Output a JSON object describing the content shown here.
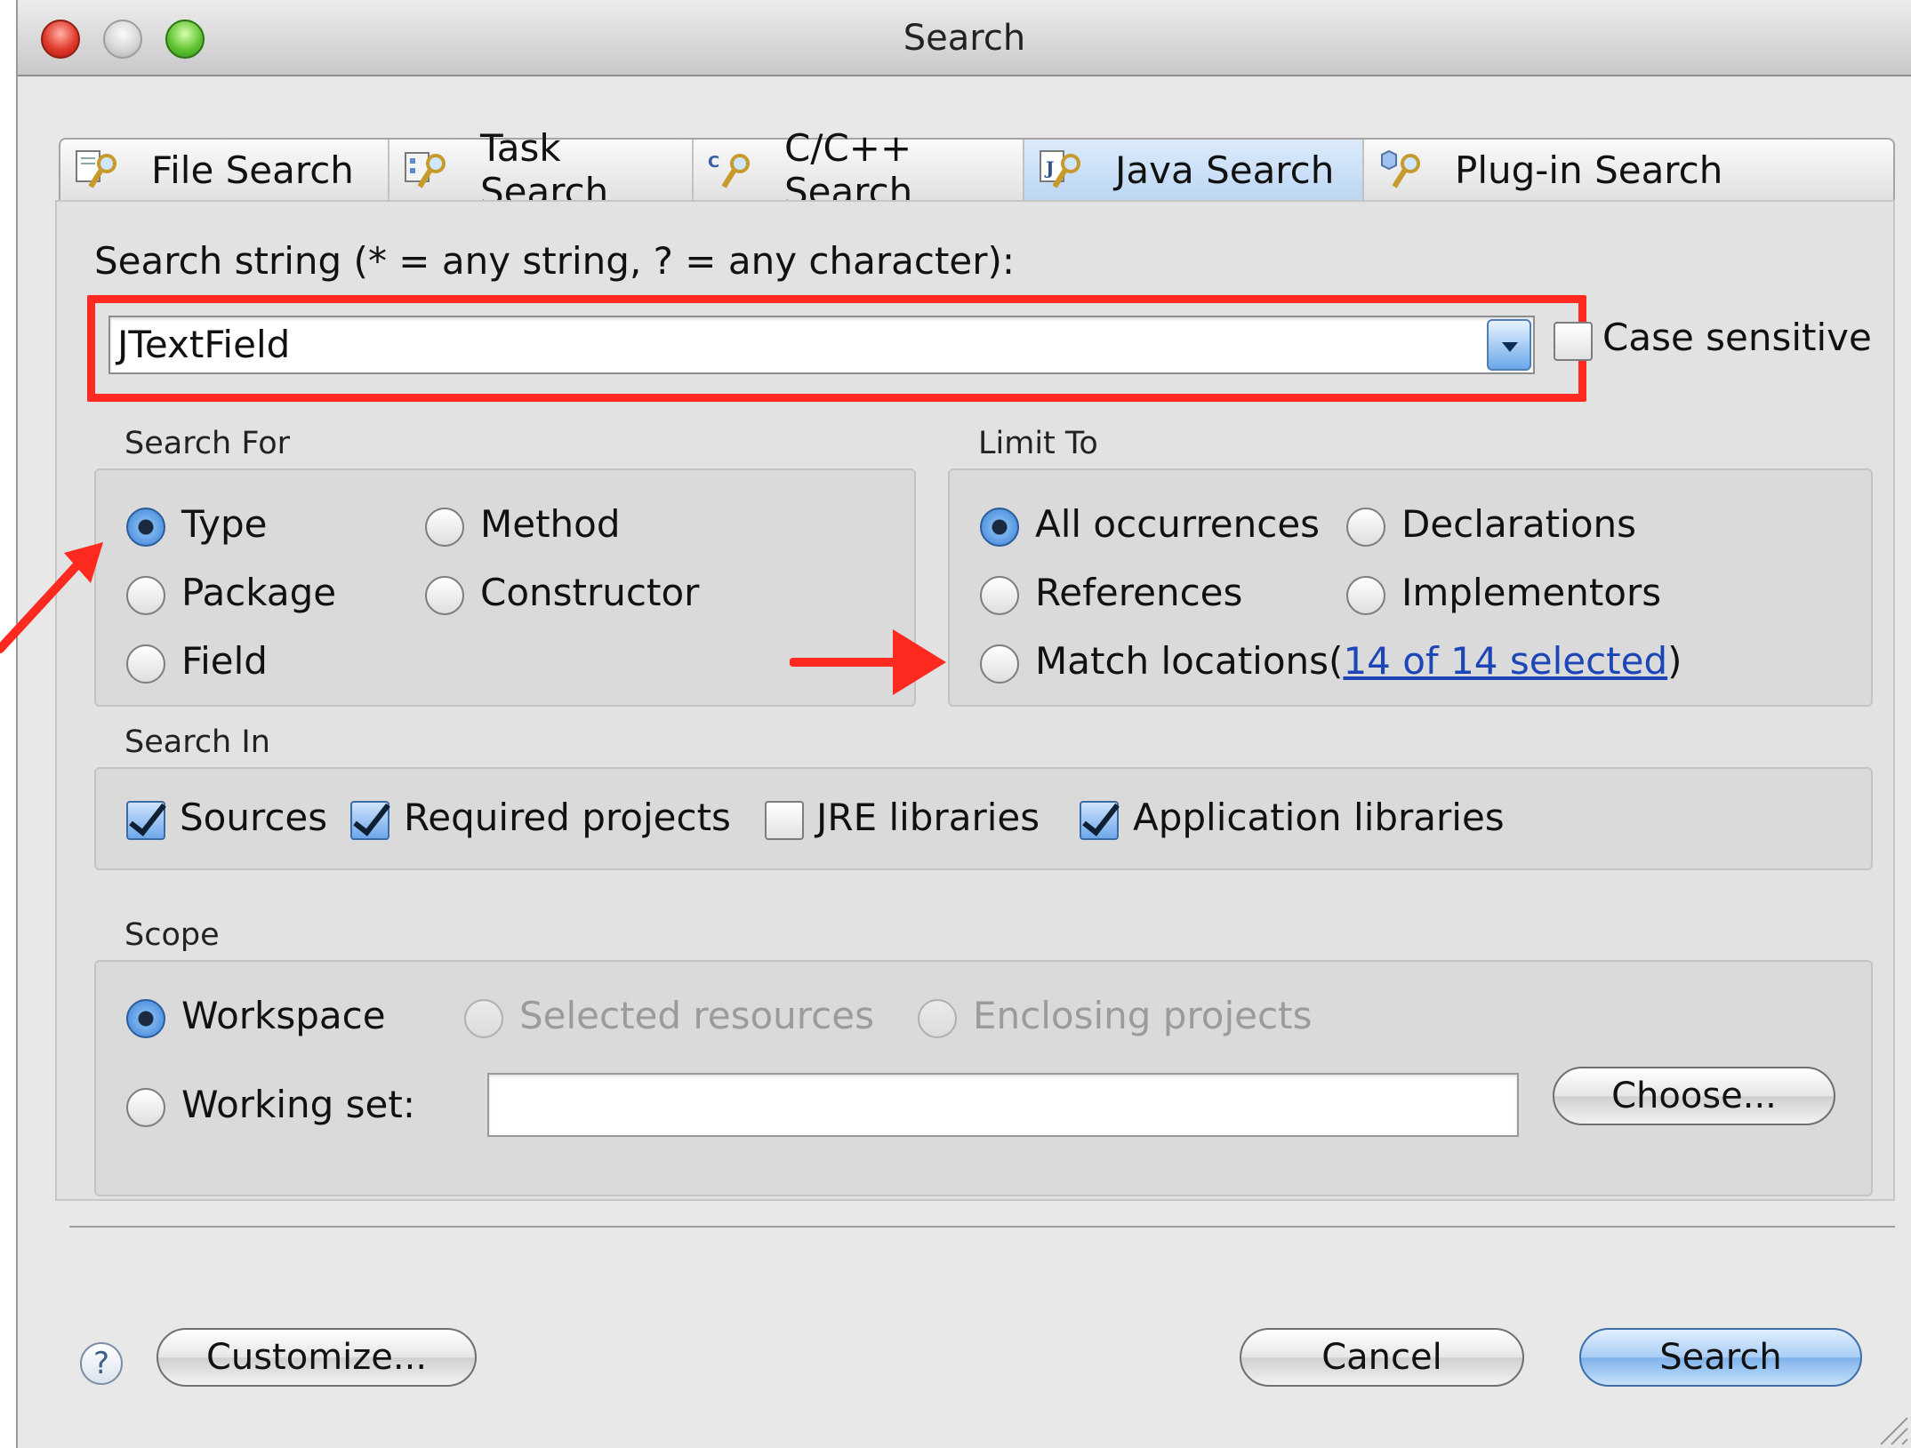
{
  "window": {
    "title": "Search"
  },
  "tabs": [
    {
      "label": "File Search",
      "icon": "file-search-icon",
      "active": false
    },
    {
      "label": "Task Search",
      "icon": "task-search-icon",
      "active": false
    },
    {
      "label": "C/C++ Search",
      "icon": "c-cpp-search-icon",
      "active": false
    },
    {
      "label": "Java Search",
      "icon": "java-search-icon",
      "active": true
    },
    {
      "label": "Plug-in Search",
      "icon": "plugin-search-icon",
      "active": false
    }
  ],
  "search_string": {
    "label": "Search string (* = any string, ? = any character):",
    "value": "JTextField",
    "case_sensitive_label": "Case sensitive",
    "case_sensitive": false
  },
  "search_for": {
    "title": "Search For",
    "options": [
      "Type",
      "Method",
      "Package",
      "Constructor",
      "Field"
    ],
    "selected": "Type"
  },
  "limit_to": {
    "title": "Limit To",
    "options": [
      "All occurrences",
      "Declarations",
      "References",
      "Implementors",
      "Match locations"
    ],
    "selected": "All occurrences",
    "paren_open": "(",
    "match_link": "14 of 14 selected",
    "paren_close": ")"
  },
  "search_in": {
    "title": "Search In",
    "items": [
      {
        "label": "Sources",
        "checked": true
      },
      {
        "label": "Required projects",
        "checked": true
      },
      {
        "label": "JRE libraries",
        "checked": false
      },
      {
        "label": "Application libraries",
        "checked": true
      }
    ]
  },
  "scope": {
    "title": "Scope",
    "workspace": "Workspace",
    "selected_resources": "Selected resources",
    "enclosing_projects": "Enclosing projects",
    "working_set": "Working set:",
    "working_set_value": "",
    "choose_button": "Choose...",
    "selected": "Workspace"
  },
  "footer": {
    "help": "?",
    "customize_button": "Customize...",
    "cancel_button": "Cancel",
    "search_button": "Search"
  },
  "colors": {
    "annotation": "#ff2a1f",
    "link": "#1c46b8",
    "accent": "#3c7ed4"
  }
}
